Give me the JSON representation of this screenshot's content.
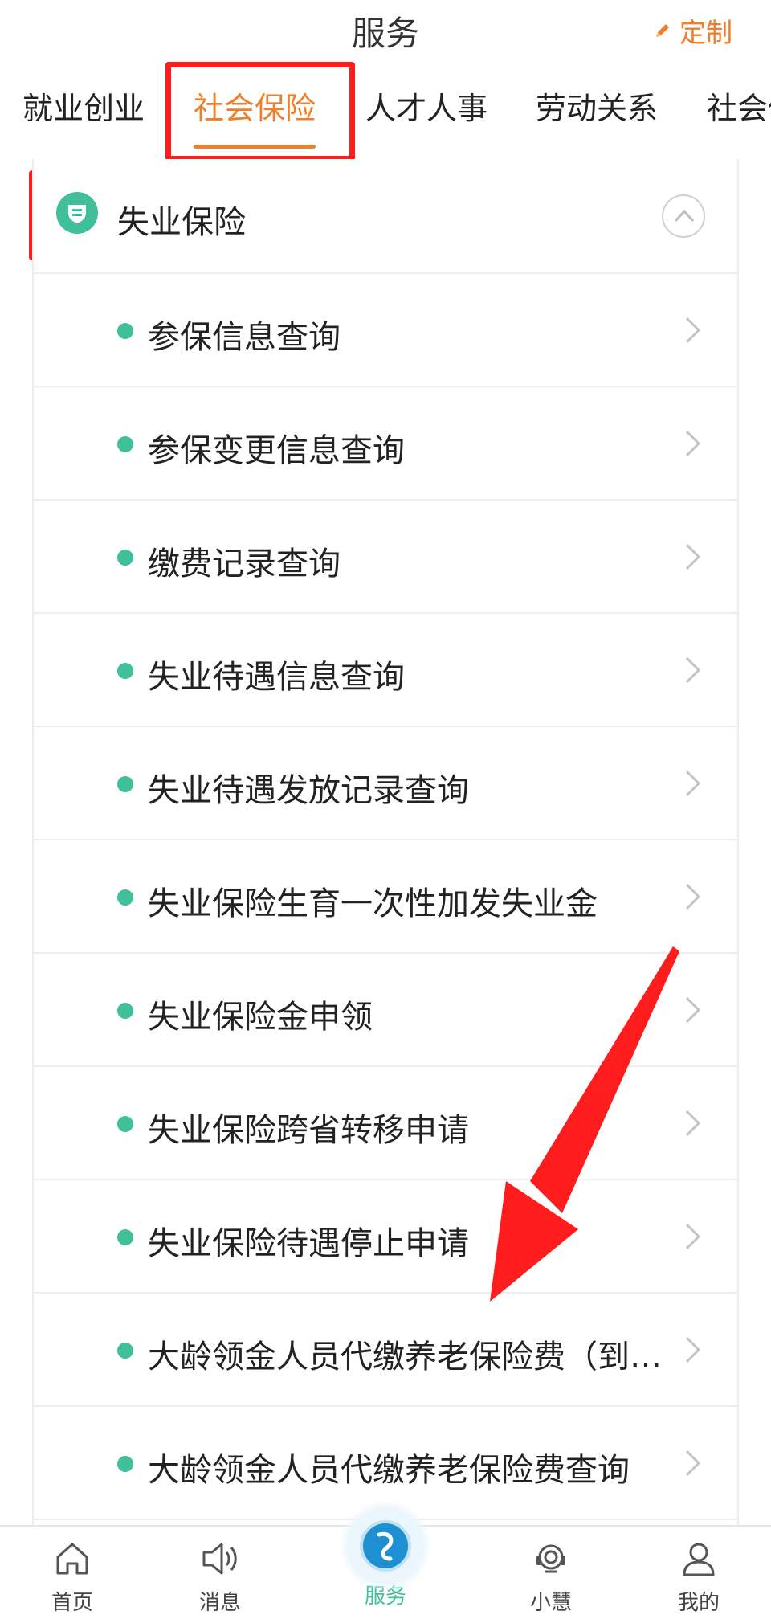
{
  "header": {
    "title": "服务",
    "customize_label": "定制"
  },
  "tabs": [
    {
      "label": "就业创业",
      "active": false
    },
    {
      "label": "社会保险",
      "active": true
    },
    {
      "label": "人才人事",
      "active": false
    },
    {
      "label": "劳动关系",
      "active": false
    },
    {
      "label": "社会保",
      "active": false
    }
  ],
  "section": {
    "title": "失业保险",
    "icon": "shield-badge-icon"
  },
  "items": [
    {
      "label": "参保信息查询"
    },
    {
      "label": "参保变更信息查询"
    },
    {
      "label": "缴费记录查询"
    },
    {
      "label": "失业待遇信息查询"
    },
    {
      "label": "失业待遇发放记录查询"
    },
    {
      "label": "失业保险生育一次性加发失业金"
    },
    {
      "label": "失业保险金申领"
    },
    {
      "label": "失业保险跨省转移申请"
    },
    {
      "label": "失业保险待遇停止申请"
    },
    {
      "label": "大龄领金人员代缴养老保险费（到户缴费）"
    },
    {
      "label": "大龄领金人员代缴养老保险费查询"
    }
  ],
  "bottom_nav": [
    {
      "label": "首页",
      "icon": "home-icon",
      "active": false
    },
    {
      "label": "消息",
      "icon": "speaker-icon",
      "active": false
    },
    {
      "label": "服务",
      "icon": "service-logo-icon",
      "active": true
    },
    {
      "label": "小慧",
      "icon": "headset-icon",
      "active": false
    },
    {
      "label": "我的",
      "icon": "user-icon",
      "active": false
    }
  ],
  "colors": {
    "accent": "#ef7f2b",
    "green": "#3fbf9a",
    "annotation_red": "#ff1c1c"
  }
}
